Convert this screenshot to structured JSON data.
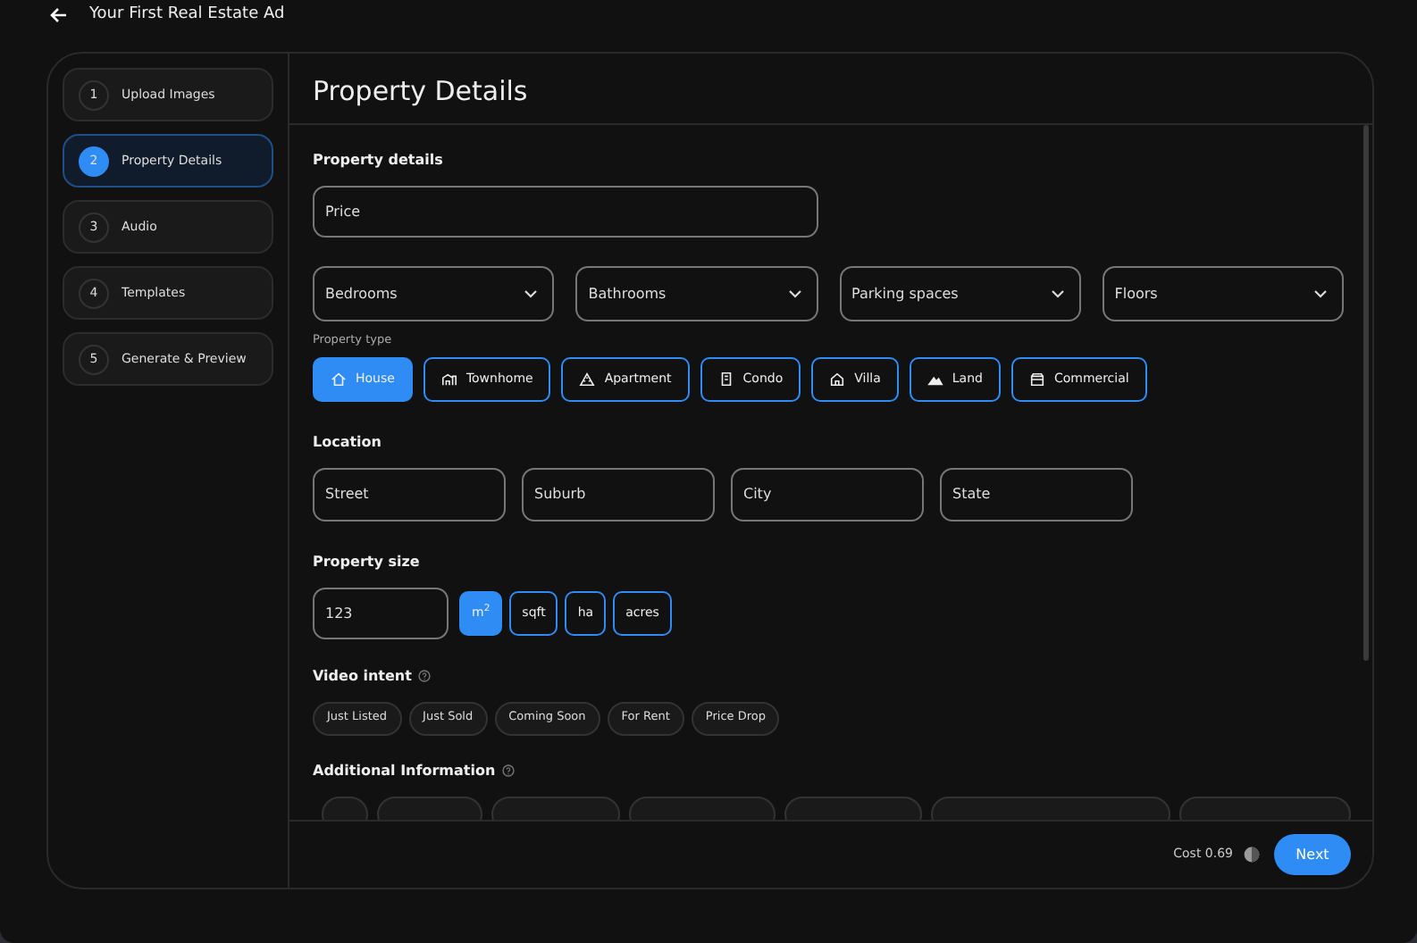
{
  "header": {
    "title": "Your First Real Estate Ad"
  },
  "steps": [
    {
      "number": "1",
      "label": "Upload Images",
      "selected": false
    },
    {
      "number": "2",
      "label": "Property Details",
      "selected": true
    },
    {
      "number": "3",
      "label": "Audio",
      "selected": false
    },
    {
      "number": "4",
      "label": "Templates",
      "selected": false
    },
    {
      "number": "5",
      "label": "Generate & Preview",
      "selected": false
    }
  ],
  "page_title": "Property Details",
  "property_details": {
    "heading": "Property details",
    "price": {
      "placeholder": "Price"
    },
    "selects": [
      {
        "placeholder": "Bedrooms"
      },
      {
        "placeholder": "Bathrooms"
      },
      {
        "placeholder": "Parking spaces"
      },
      {
        "placeholder": "Floors"
      }
    ],
    "property_type_label": "Property type",
    "property_types": [
      {
        "label": "House",
        "selected": true
      },
      {
        "label": "Townhome",
        "selected": false
      },
      {
        "label": "Apartment",
        "selected": false
      },
      {
        "label": "Condo",
        "selected": false
      },
      {
        "label": "Villa",
        "selected": false
      },
      {
        "label": "Land",
        "selected": false
      },
      {
        "label": "Commercial",
        "selected": false
      }
    ]
  },
  "location": {
    "heading": "Location",
    "fields": [
      {
        "placeholder": "Street"
      },
      {
        "placeholder": "Suburb"
      },
      {
        "placeholder": "City"
      },
      {
        "placeholder": "State"
      }
    ]
  },
  "property_size": {
    "heading": "Property size",
    "field": {
      "placeholder": "123"
    },
    "units": [
      {
        "label": "m$^{2}$",
        "selected": true
      },
      {
        "label": "sqft",
        "selected": false
      },
      {
        "label": "ha",
        "selected": false
      },
      {
        "label": "acres",
        "selected": false
      }
    ]
  },
  "video_intent": {
    "heading": "Video intent",
    "options": [
      {
        "label": "Just Listed",
        "selected": false
      },
      {
        "label": "Just Sold",
        "selected": false
      },
      {
        "label": "Coming Soon",
        "selected": false
      },
      {
        "label": "For Rent",
        "selected": false
      },
      {
        "label": "Price Drop",
        "selected": false
      }
    ]
  },
  "additional_information": {
    "heading": "Additional Information"
  },
  "footer": {
    "cost": "Cost 0.69",
    "next_button": "Next"
  }
}
